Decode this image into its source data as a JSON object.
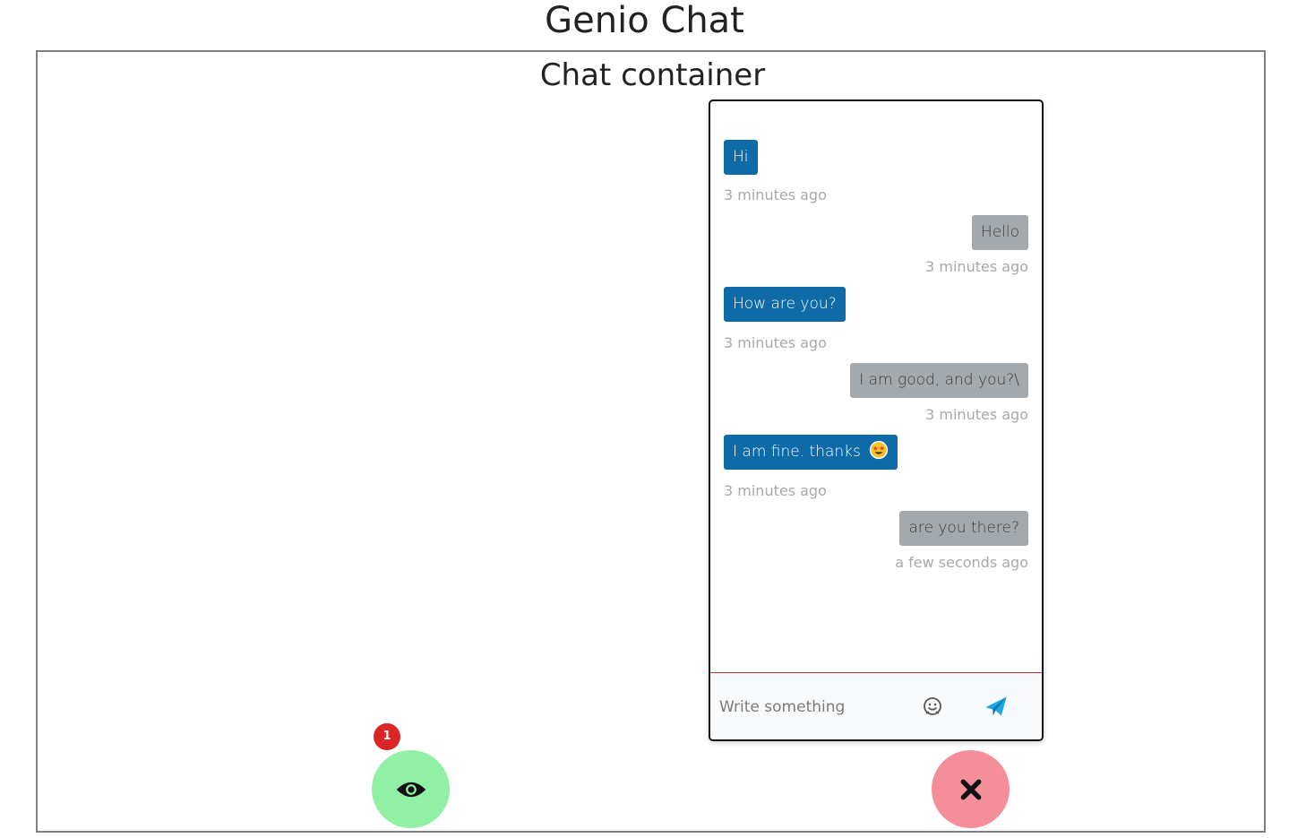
{
  "page": {
    "title": "Genio Chat"
  },
  "container": {
    "title": "Chat container"
  },
  "chat": {
    "messages": [
      {
        "text": "Hi",
        "side": "sent",
        "time": "3 minutes ago"
      },
      {
        "text": "Hello",
        "side": "recv",
        "time": "3 minutes ago"
      },
      {
        "text": "How are you?",
        "side": "sent",
        "time": "3 minutes ago"
      },
      {
        "text": "I am good, and you?\\",
        "side": "recv",
        "time": "3 minutes ago"
      },
      {
        "text": "I am fine. thanks",
        "side": "sent",
        "time": "3 minutes ago",
        "emoji": "star-struck-emoji"
      },
      {
        "text": "are you there?",
        "side": "recv",
        "time": "a few seconds ago"
      }
    ],
    "input": {
      "placeholder": "Write something",
      "value": ""
    },
    "icons": {
      "emoji_button": "smiley-icon",
      "send_button": "paper-plane-icon"
    },
    "colors": {
      "sent_bubble": "#0e6ba8",
      "received_bubble": "#a4a9ad",
      "send_icon": "#1ea7e6",
      "input_divider": "#d32f2f"
    }
  },
  "controls": {
    "view_button": {
      "icon": "eye-icon",
      "badge_count": "1",
      "color": "#90f0a4"
    },
    "close_button": {
      "icon": "close-icon",
      "color": "#f48e98"
    },
    "badge_color": "#dc2626"
  }
}
